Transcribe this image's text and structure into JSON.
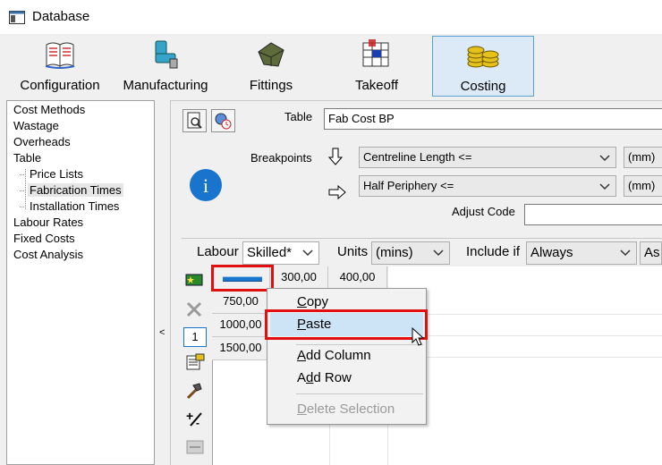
{
  "window": {
    "title": "Database"
  },
  "ribbon": [
    {
      "label": "Configuration",
      "icon": "book-icon"
    },
    {
      "label": "Manufacturing",
      "icon": "pipe-icon"
    },
    {
      "label": "Fittings",
      "icon": "fitting-icon"
    },
    {
      "label": "Takeoff",
      "icon": "takeoff-icon"
    },
    {
      "label": "Costing",
      "icon": "coins-icon",
      "selected": true
    }
  ],
  "tree": {
    "items": [
      "Cost Methods",
      "Wastage",
      "Overheads",
      "Table",
      "Price Lists",
      "Fabrication Times",
      "Installation Times",
      "Labour Rates",
      "Fixed Costs",
      "Cost Analysis"
    ],
    "selected": "Fabrication Times"
  },
  "splitter": {
    "arrow": "<"
  },
  "table": {
    "label": "Table",
    "value": "Fab Cost BP",
    "breakpoints_label": "Breakpoints",
    "breakpoint1": "Centreline Length <=",
    "breakpoint1_unit": "(mm)",
    "breakpoint2": "Half Periphery <=",
    "breakpoint2_unit": "(mm)",
    "adjust_code_label": "Adjust Code",
    "adjust_code_value": "",
    "info_glyph": "i"
  },
  "options": {
    "labour_label": "Labour",
    "labour_value": "Skilled*",
    "units_label": "Units",
    "units_value": "(mins)",
    "include_label": "Include if",
    "include_value": "Always",
    "extra_value": "As"
  },
  "grid": {
    "columns": [
      "",
      "300,00",
      "400,00"
    ],
    "rows": [
      "750,00",
      "1000,00",
      "1500,00"
    ],
    "row_spin_value": "1"
  },
  "context_menu": {
    "items": [
      {
        "prefix": "",
        "underline": "C",
        "rest": "opy",
        "enabled": true
      },
      {
        "prefix": "",
        "underline": "P",
        "rest": "aste",
        "enabled": true,
        "highlighted": true
      },
      {
        "prefix": "",
        "underline": "A",
        "rest": "dd Column",
        "enabled": true
      },
      {
        "prefix": "A",
        "underline": "d",
        "rest": "d Row",
        "enabled": true
      },
      {
        "prefix": "",
        "underline": "D",
        "rest": "elete Selection",
        "enabled": false
      }
    ]
  },
  "colors": {
    "accent": "#1874cd",
    "highlight": "#cde4f7",
    "callout": "#e01010",
    "disabled": "#9a9a9a"
  }
}
